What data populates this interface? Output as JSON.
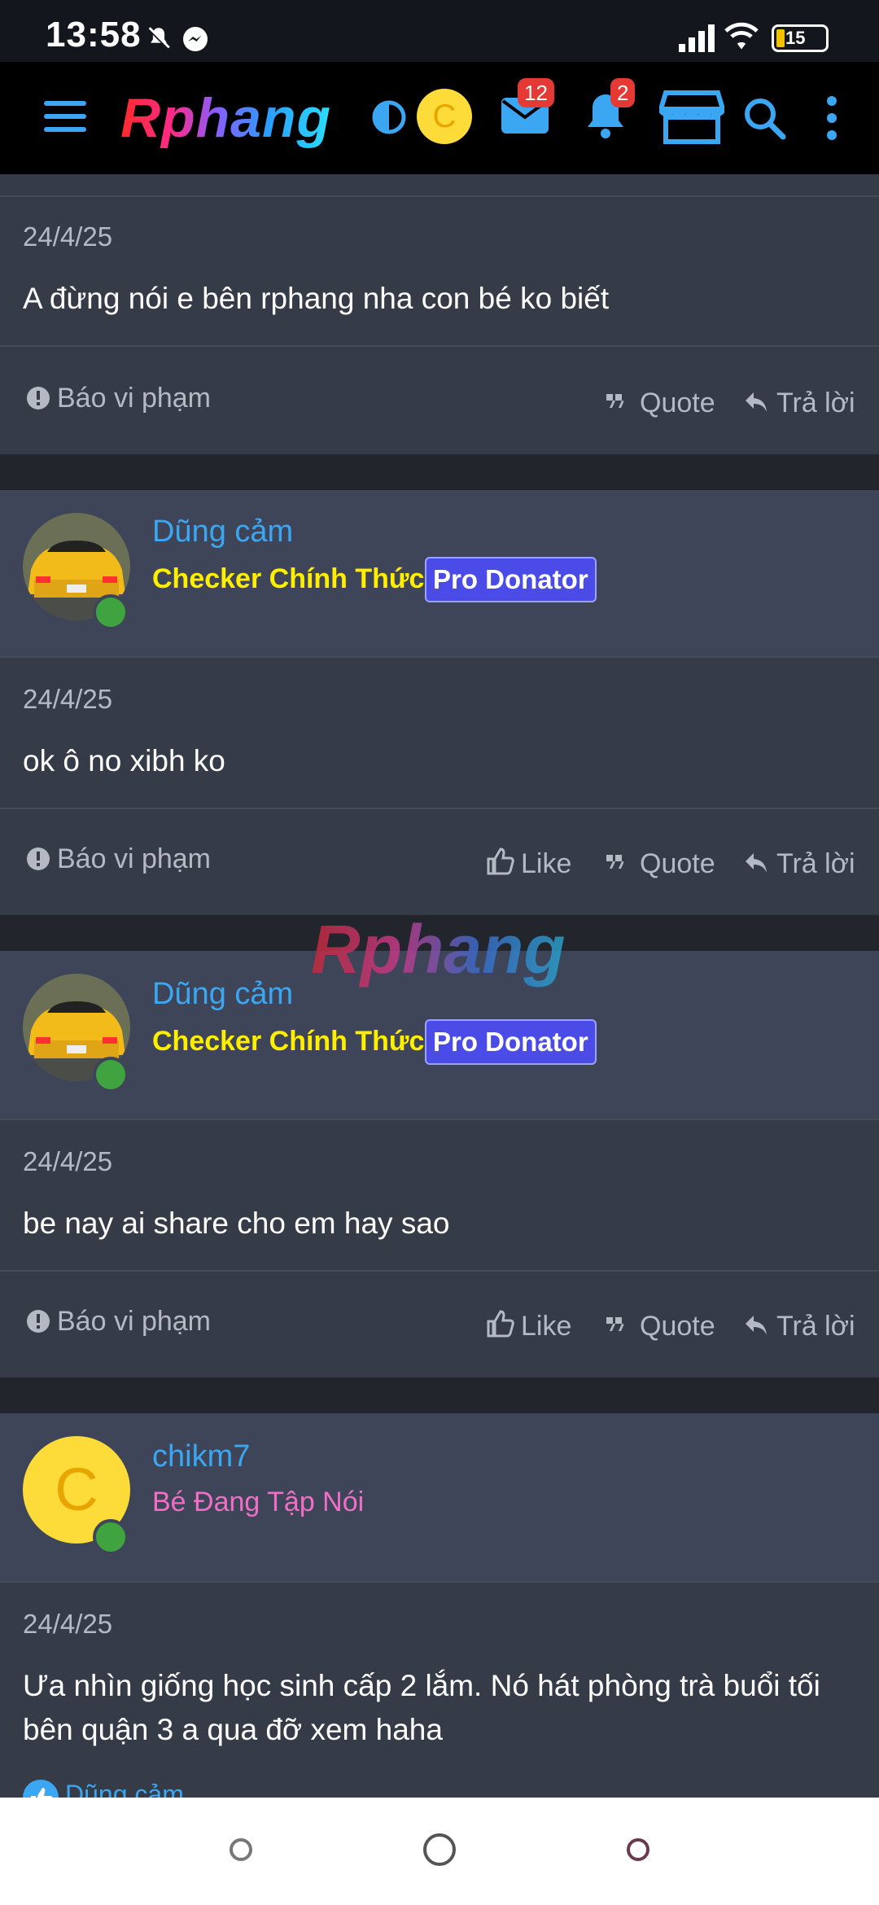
{
  "status_bar": {
    "time": "13:58",
    "battery": "15"
  },
  "header": {
    "logo": "Rphang",
    "avatar_letter": "C",
    "messages_count": "12",
    "alerts_count": "2"
  },
  "watermark": "Rphang",
  "posts": [
    {
      "date": "24/4/25",
      "text": "A đừng nói e bên rphang nha con bé ko biết",
      "report": "Báo vi phạm",
      "quote": "Quote",
      "reply": "Trả lời"
    },
    {
      "username": "Dũng cảm",
      "title": "Checker Chính Thức",
      "badge": "Pro Donator",
      "date": "24/4/25",
      "text": "ok ô no xibh ko",
      "report": "Báo vi phạm",
      "like": "Like",
      "quote": "Quote",
      "reply": "Trả lời"
    },
    {
      "username": "Dũng cảm",
      "title": "Checker Chính Thức",
      "badge": "Pro Donator",
      "date": "24/4/25",
      "text": "be nay ai share cho em hay sao",
      "report": "Báo vi phạm",
      "like": "Like",
      "quote": "Quote",
      "reply": "Trả lời"
    },
    {
      "username": "chikm7",
      "avatar_letter": "C",
      "title": "Bé Đang Tập Nói",
      "date": "24/4/25",
      "text": "Ưa nhìn giống học sinh cấp 2 lắm. Nó hát phòng trà buổi tối bên quận 3 a qua đỡ xem haha",
      "reaction_user": "Dũng cảm"
    }
  ],
  "colors": {
    "accent": "#3ba7f2",
    "header_bg": "#000000",
    "badge_red": "#e53935"
  }
}
